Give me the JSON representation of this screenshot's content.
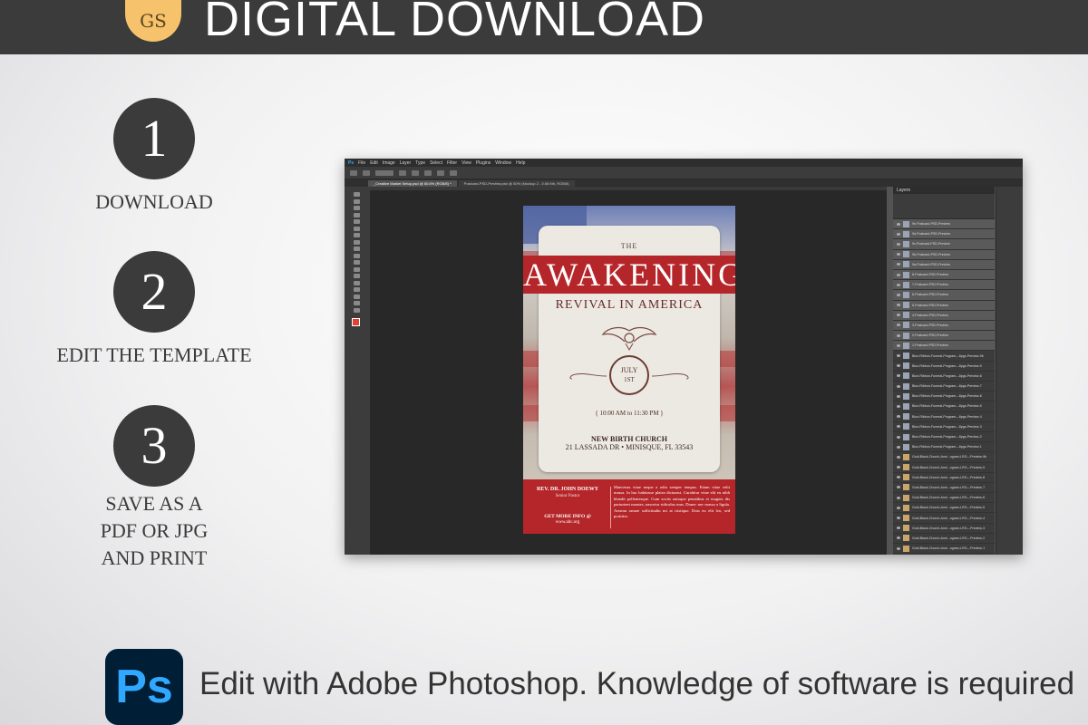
{
  "header": {
    "badge": "GS",
    "title": "DIGITAL DOWNLOAD"
  },
  "steps": [
    {
      "number": "1",
      "label": "DOWNLOAD"
    },
    {
      "number": "2",
      "label": "EDIT THE TEMPLATE"
    },
    {
      "number": "3",
      "label_lines": [
        "SAVE AS A",
        "PDF OR JPG",
        "AND PRINT"
      ]
    }
  ],
  "photoshop": {
    "menu": [
      "Ps",
      "File",
      "Edit",
      "Image",
      "Layer",
      "Type",
      "Select",
      "Filter",
      "View",
      "Plugins",
      "Window",
      "Help"
    ],
    "tabs": [
      "_Creative Market Setup.psd @ 60.6% (RGB/8) *",
      "Postcard-PSD-Preview.psb @ 50% (Mockup 2 - 0.66 Mb, RGB/8)"
    ],
    "panel_title": "Layers",
    "layers": [
      "9e-Postcard-PSD-Preview",
      "9d-Postcard-PSD-Preview",
      "9c-Postcard-PSD-Preview",
      "9b-Postcard-PSD-Preview",
      "9a-Postcard-PSD-Preview",
      "8-Postcard-PSD-Preview",
      "7-Postcard-PSD-Preview",
      "6-Postcard-PSD-Preview",
      "5-Postcard-PSD-Preview",
      "4-Postcard-PSD-Preview",
      "3-Postcard-PSD-Preview",
      "2-Postcard-PSD-Preview",
      "1-Postcard-PSD-Preview",
      "Blue-Ribbon-Funeral-Program---8pgs-Preview-9b",
      "Blue-Ribbon-Funeral-Program---8pgs-Preview-9",
      "Blue-Ribbon-Funeral-Program---8pgs-Preview-8",
      "Blue-Ribbon-Funeral-Program---8pgs-Preview-7",
      "Blue-Ribbon-Funeral-Program---8pgs-Preview-6",
      "Blue-Ribbon-Funeral-Program---8pgs-Preview-5",
      "Blue-Ribbon-Funeral-Program---8pgs-Preview-4",
      "Blue-Ribbon-Funeral-Program---8pgs-Preview-3",
      "Blue-Ribbon-Funeral-Program---8pgs-Preview-2",
      "Blue-Ribbon-Funeral-Program---8pgs-Preview-1",
      "Gold-Black-Church-Anni...ogram-LRG---Preview-9b",
      "Gold-Black-Church-Anni...ogram-LRG---Preview-9",
      "Gold-Black-Church-Anni...ogram-LRG---Preview-8",
      "Gold-Black-Church-Anni...ogram-LRG---Preview-7",
      "Gold-Black-Church-Anni...ogram-LRG---Preview-6",
      "Gold-Black-Church-Anni...ogram-LRG---Preview-5",
      "Gold-Black-Church-Anni...ogram-LRG---Preview-4",
      "Gold-Black-Church-Anni...ogram-LRG---Preview-3",
      "Gold-Black-Church-Anni...ogram-LRG---Preview-2",
      "Gold-Black-Church-Anni...ogram-LRG---Preview-1"
    ]
  },
  "flyer": {
    "the": "THE",
    "title": "AWAKENING",
    "subtitle": "REVIVAL IN AMERICA",
    "month": "JULY",
    "day": "1ST",
    "time": "{ 10:00 AM to 11:30 PM }",
    "church": "NEW BIRTH CHURCH",
    "address": "21 LASSADA DR • MINISQUE, FL 33543",
    "pastor": "REV. DR. JOHN DOEWY",
    "role": "Senior Pastor",
    "more": "GET MORE INFO @",
    "web": "www.abc.org",
    "body": "Maecenas vitae neque a odio semper tempus. Etiam vitae velit massa. In hac habitasse platea dictumst. Curabitur vitae elit eu nibh blandit pellentesque. Cum sociis natoque penatibus et magnis dis parturient montes, nascetur ridiculus mus. Donec nec massa a ligula. Aenean ornare sollicitudin mi at tristique. Duis eu elit leo, sed porttitor."
  },
  "footer": {
    "ps_icon": "Ps",
    "text": "Edit with Adobe Photoshop. Knowledge of software is required"
  },
  "colors": {
    "header": "#3b3b3b",
    "badge": "#f6c36c",
    "flyer_red": "#b5262a",
    "ps_blue": "#31a8ff",
    "ps_bg": "#001e36"
  }
}
